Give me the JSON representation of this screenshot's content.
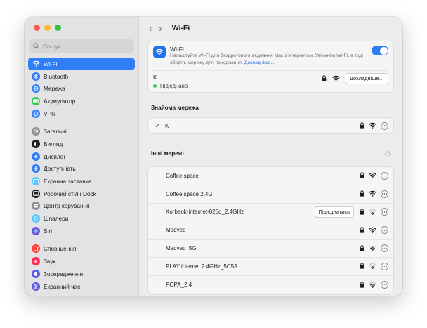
{
  "sidebar": {
    "search_placeholder": "Пошук",
    "groups": [
      [
        {
          "label": "Wi-Fi",
          "icon": "wifi-icon",
          "color": "#2f7ef6",
          "active": true
        },
        {
          "label": "Bluetooth",
          "icon": "bluetooth-icon",
          "color": "#2f7ef6"
        },
        {
          "label": "Мережа",
          "icon": "globe-icon",
          "color": "#2f7ef6"
        },
        {
          "label": "Акумулятор",
          "icon": "battery-icon",
          "color": "#34c759"
        },
        {
          "label": "VPN",
          "icon": "vpn-globe-icon",
          "color": "#2f7ef6"
        }
      ],
      [
        {
          "label": "Загальні",
          "icon": "gear-icon",
          "color": "#8e8e93"
        },
        {
          "label": "Вигляд",
          "icon": "appearance-icon",
          "color": "#1d1d1f"
        },
        {
          "label": "Дисплеї",
          "icon": "display-sun-icon",
          "color": "#2f7ef6"
        },
        {
          "label": "Доступність",
          "icon": "accessibility-icon",
          "color": "#2f7ef6"
        },
        {
          "label": "Екранна заставка",
          "icon": "screensaver-icon",
          "color": "#5ac8fa"
        },
        {
          "label": "Робочий стіл і Dock",
          "icon": "dock-icon",
          "color": "#1d1d1f"
        },
        {
          "label": "Центр керування",
          "icon": "control-center-icon",
          "color": "#8e8e93"
        },
        {
          "label": "Шпалери",
          "icon": "wallpaper-icon",
          "color": "#5ac8fa"
        },
        {
          "label": "Siri",
          "icon": "siri-icon",
          "color": "#5e5ce6"
        }
      ],
      [
        {
          "label": "Сповіщення",
          "icon": "bell-icon",
          "color": "#ff3b30"
        },
        {
          "label": "Звук",
          "icon": "speaker-icon",
          "color": "#ff2d55"
        },
        {
          "label": "Зосередження",
          "icon": "moon-icon",
          "color": "#5e5ce6"
        },
        {
          "label": "Екранний час",
          "icon": "hourglass-icon",
          "color": "#5e5ce6"
        }
      ]
    ]
  },
  "toolbar": {
    "back": "‹",
    "forward": "›",
    "title": "Wi-Fi"
  },
  "wifi": {
    "title": "Wi-Fi",
    "description": "Налаштуйте Wi-Fi для бездротового з'єднання Mac з інтернетом. Увімкніть Wi-Fi, а тоді оберіть мережу для приєднання.",
    "link": "Докладніше…",
    "enabled": true,
    "current_network": "K",
    "status": "Під'єднано",
    "details_button": "Докладніше…"
  },
  "known": {
    "title": "Знайома мережа",
    "networks": [
      {
        "name": "K",
        "check": "✓"
      }
    ]
  },
  "other": {
    "title": "Інші мережі",
    "join_button": "Під'єднатись",
    "networks": [
      {
        "name": "Coffee space",
        "secured": true,
        "strength": "full"
      },
      {
        "name": "Coffee space 2,4G",
        "secured": true,
        "strength": "full"
      },
      {
        "name": "Korbank-internet-825d_2.4GHz",
        "secured": true,
        "strength": "low",
        "join": true
      },
      {
        "name": "Medved",
        "secured": true,
        "strength": "full"
      },
      {
        "name": "Medved_5G",
        "secured": true,
        "strength": "medium"
      },
      {
        "name": "PLAY internet 2.4GHz_5C5A",
        "secured": true,
        "strength": "low"
      },
      {
        "name": "POPA_2.4",
        "secured": true,
        "strength": "medium"
      }
    ]
  }
}
